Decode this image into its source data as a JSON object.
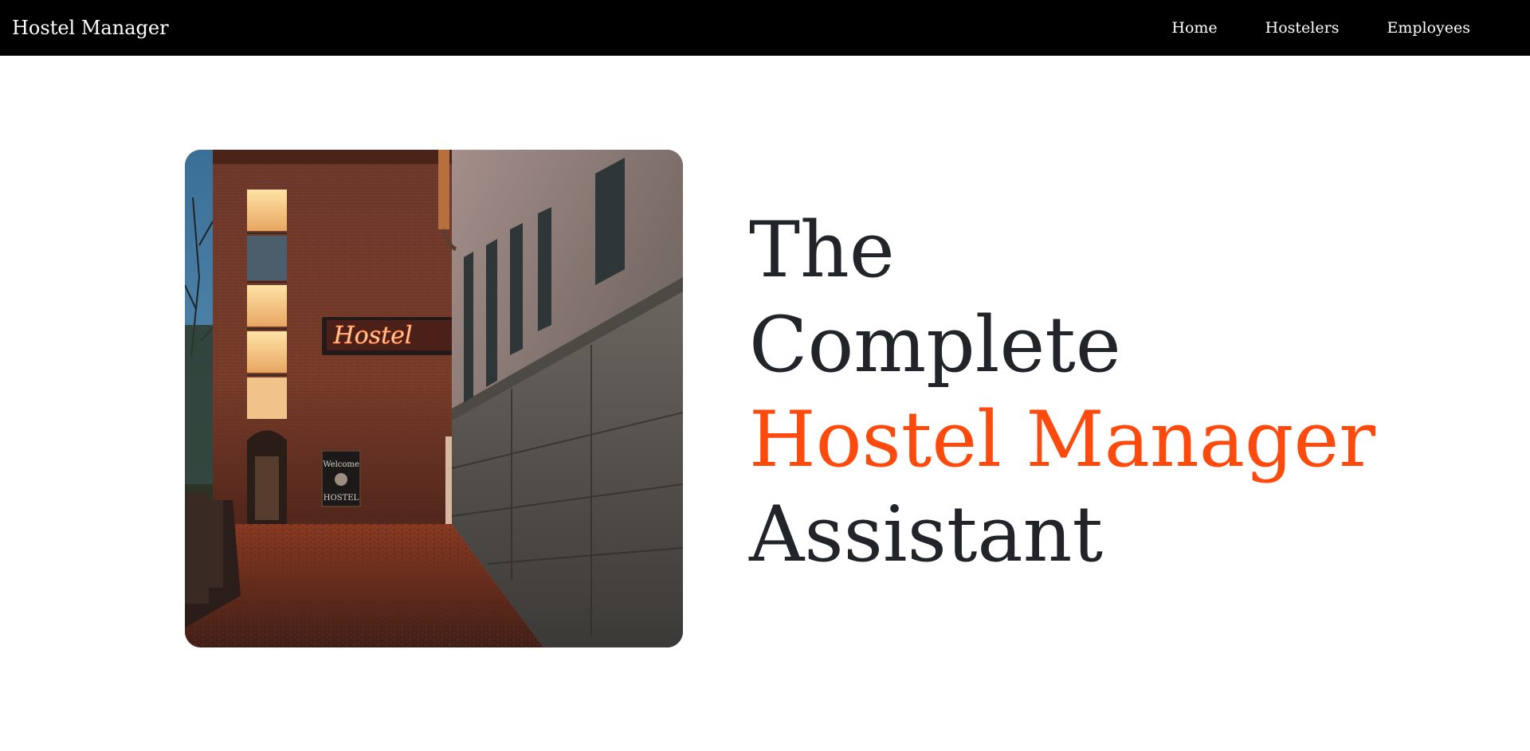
{
  "navbar": {
    "brand": "Hostel Manager",
    "links": [
      {
        "label": "Home"
      },
      {
        "label": "Hostelers"
      },
      {
        "label": "Employees"
      }
    ]
  },
  "hero": {
    "image": {
      "neon_sign": "Hostel",
      "chalkboard_top": "Welcome",
      "chalkboard_bottom": "HOSTEL"
    },
    "headline": {
      "line1": "The",
      "line2": "Complete",
      "line3": "Hostel Manager",
      "line4": "Assistant"
    }
  },
  "colors": {
    "navbar_bg": "#000000",
    "accent": "#ff4a0d",
    "text_dark": "#212529"
  }
}
